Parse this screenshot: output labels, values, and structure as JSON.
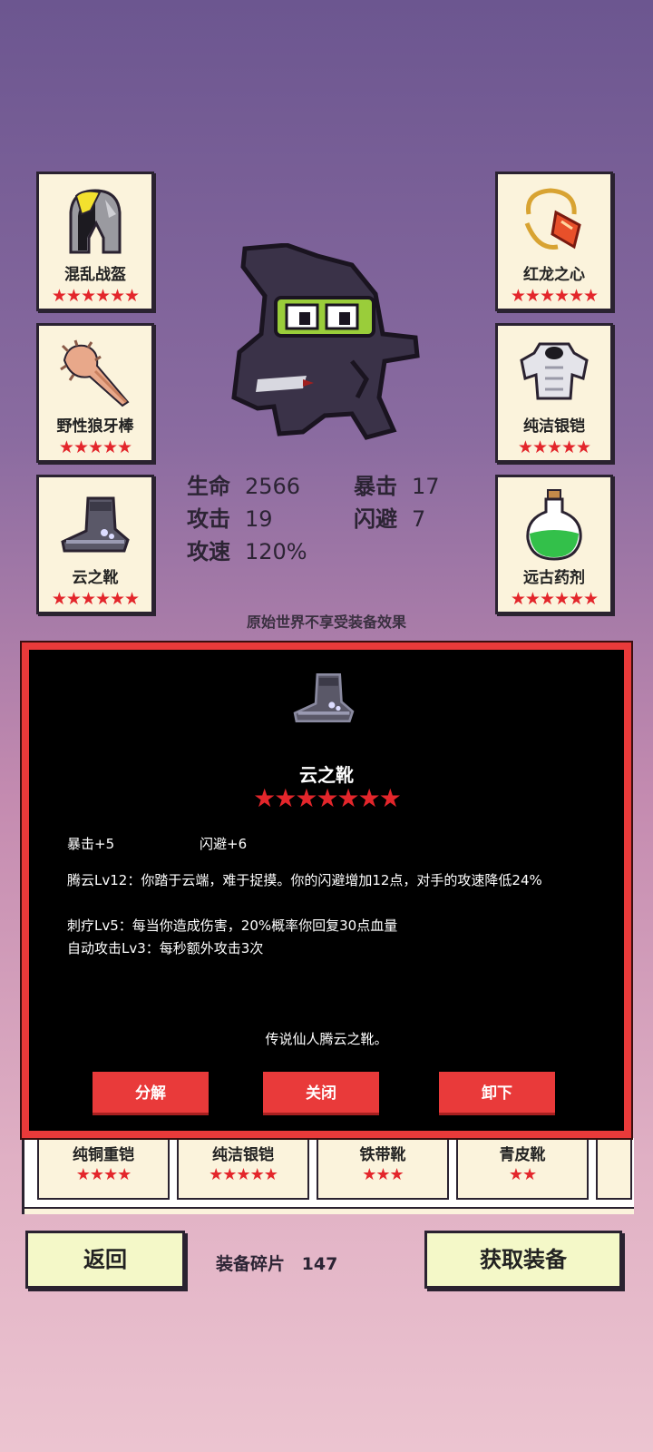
{
  "equipment_slots": {
    "left": [
      {
        "name": "混乱战盔",
        "stars": "★★★★★★",
        "icon": "helmet-icon"
      },
      {
        "name": "野性狼牙棒",
        "stars": "★★★★★",
        "icon": "club-icon"
      },
      {
        "name": "云之靴",
        "stars": "★★★★★★",
        "icon": "boots-icon"
      }
    ],
    "right": [
      {
        "name": "红龙之心",
        "stars": "★★★★★★",
        "icon": "amulet-icon"
      },
      {
        "name": "纯洁银铠",
        "stars": "★★★★★",
        "icon": "armor-icon"
      },
      {
        "name": "远古药剂",
        "stars": "★★★★★★",
        "icon": "potion-icon"
      }
    ]
  },
  "stats": {
    "hp_label": "生命",
    "hp": "2566",
    "crit_label": "暴击",
    "crit": "17",
    "atk_label": "攻击",
    "atk": "19",
    "dodge_label": "闪避",
    "dodge": "7",
    "spd_label": "攻速",
    "spd": "120%"
  },
  "note": "原始世界不享受装备效果",
  "detail": {
    "name": "云之靴",
    "stars": "★★★★★★★",
    "attr1": "暴击+5",
    "attr2": "闪避+6",
    "desc1": "腾云Lv12：你踏于云端，难于捉摸。你的闪避增加12点，对手的攻速降低24%",
    "desc2": "刺疗Lv5：每当你造成伤害，20%概率你回复30点血量",
    "desc3": "自动攻击Lv3：每秒额外攻击3次",
    "flavor": "传说仙人腾云之靴。",
    "buttons": {
      "decompose": "分解",
      "close": "关闭",
      "unequip": "卸下"
    }
  },
  "inventory": [
    {
      "name": "纯铜重铠",
      "stars": "★★★★"
    },
    {
      "name": "纯洁银铠",
      "stars": "★★★★★"
    },
    {
      "name": "铁带靴",
      "stars": "★★★"
    },
    {
      "name": "青皮靴",
      "stars": "★★"
    }
  ],
  "footer": {
    "back": "返回",
    "shards_label": "装备碎片",
    "shards": "147",
    "get_equipment": "获取装备"
  },
  "colors": {
    "accent_red": "#e93a3a",
    "card_bg": "#fbf3dc",
    "button_bg": "#f4f8c8"
  }
}
